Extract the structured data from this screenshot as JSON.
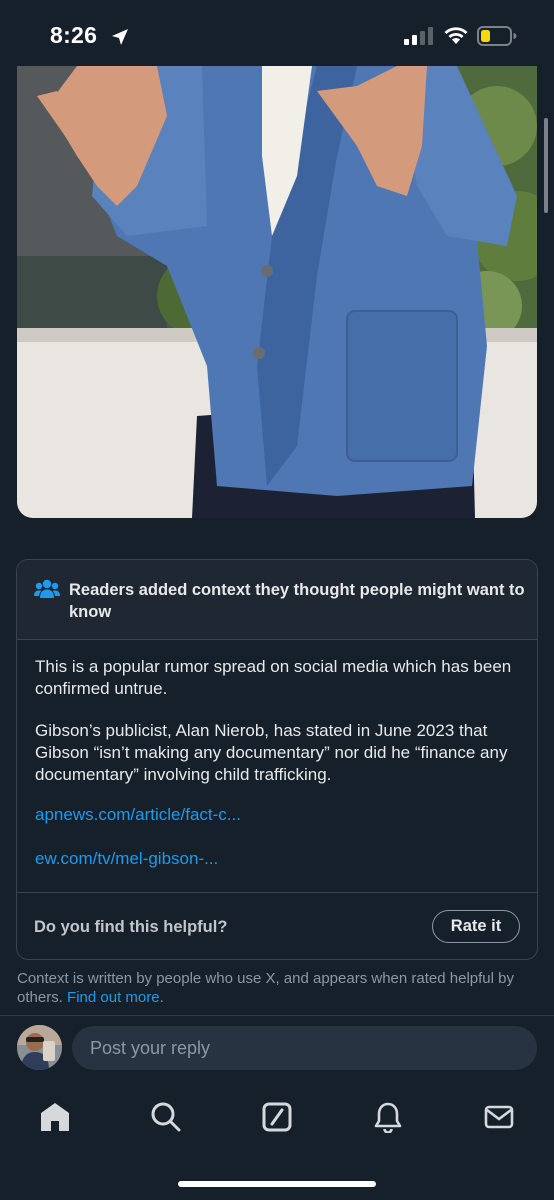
{
  "status_bar": {
    "time": "8:26",
    "icons": [
      "location-arrow-icon",
      "cellular-signal-icon",
      "wifi-icon",
      "battery-low-icon"
    ],
    "battery_color": "#f5d90a"
  },
  "post_media": {
    "description_icon": "photo"
  },
  "community_note": {
    "header": "Readers added context they thought people might want to know",
    "paragraphs": [
      "This is a popular rumor spread on social media which has been confirmed untrue.",
      "Gibson’s publicist, Alan Nierob, has stated in June 2023 that Gibson “isn’t making any documentary” nor did he “finance any documentary” involving child trafficking."
    ],
    "links": [
      "apnews.com/article/fact-c...",
      "ew.com/tv/mel-gibson-..."
    ],
    "helpful_question": "Do you find this helpful?",
    "rate_button": "Rate it"
  },
  "context_info": {
    "text": "Context is written by people who use X, and appears when rated helpful by others.",
    "link": "Find out more",
    "suffix": "."
  },
  "reply": {
    "placeholder": "Post your reply"
  },
  "bottom_nav": {
    "items": [
      "home-icon",
      "search-icon",
      "grok-icon",
      "notifications-bell-icon",
      "messages-mail-icon"
    ]
  },
  "colors": {
    "background": "#15202b",
    "accent": "#1d9bf0",
    "text": "#e7e9ea",
    "muted": "#8b98a5",
    "border": "#38444d"
  }
}
